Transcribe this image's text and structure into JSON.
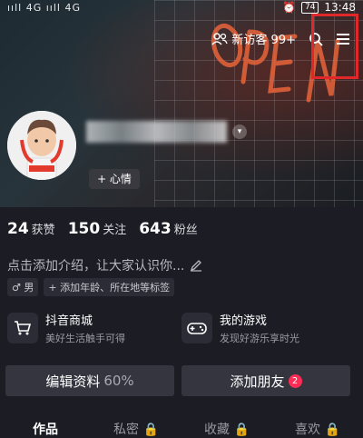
{
  "status_bar": {
    "left_text": "ııll 4G ııll 4G",
    "time": "13:48",
    "battery": "74"
  },
  "header": {
    "visitors_label": "新访客 99+"
  },
  "profile": {
    "mood_label": "+ 心情"
  },
  "stats": [
    {
      "value": "24",
      "label": "获赞"
    },
    {
      "value": "150",
      "label": "关注"
    },
    {
      "value": "643",
      "label": "粉丝"
    }
  ],
  "bio": {
    "placeholder": "点击添加介绍，让大家认识你..."
  },
  "tags": [
    {
      "label": "♂ 男"
    },
    {
      "label": "+ 添加年龄、所在地等标签"
    }
  ],
  "cards": [
    {
      "title": "抖音商城",
      "subtitle": "美好生活触手可得"
    },
    {
      "title": "我的游戏",
      "subtitle": "发现好游乐享时光"
    }
  ],
  "actions": {
    "edit_label": "编辑资料",
    "edit_percent": "60%",
    "add_friend_label": "添加朋友",
    "add_friend_badge": "2"
  },
  "tabs": [
    "作品",
    "私密 🔒",
    "收藏 🔒",
    "喜欢 🔒"
  ],
  "colors": {
    "accent": "#fe2c55",
    "highlight": "#e0282a"
  }
}
